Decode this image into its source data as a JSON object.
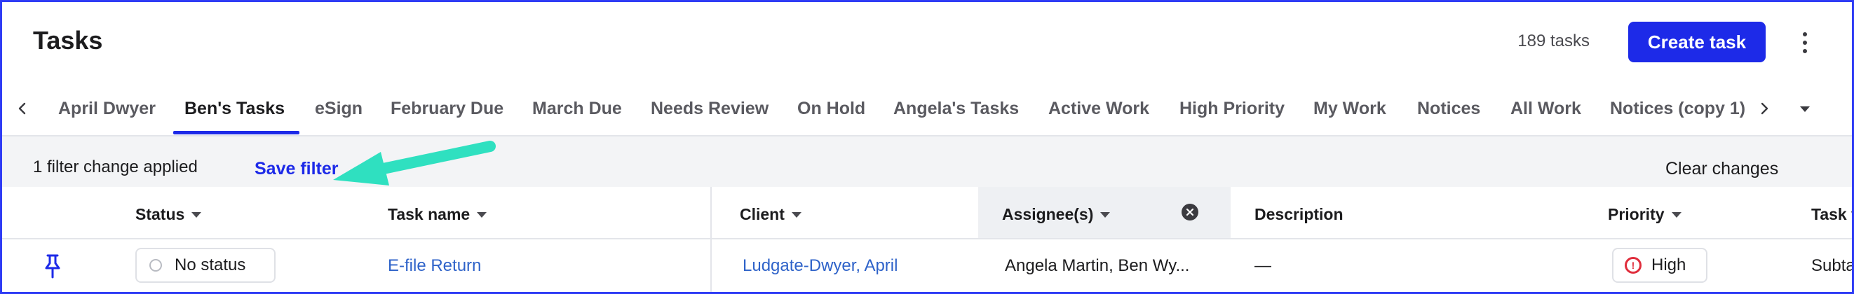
{
  "header": {
    "title": "Tasks",
    "task_count": "189 tasks",
    "create_label": "Create task"
  },
  "tabs": [
    {
      "label": "April Dwyer"
    },
    {
      "label": "Ben's Tasks"
    },
    {
      "label": "eSign"
    },
    {
      "label": "February Due"
    },
    {
      "label": "March Due"
    },
    {
      "label": "Needs Review"
    },
    {
      "label": "On Hold"
    },
    {
      "label": "Angela's Tasks"
    },
    {
      "label": "Active Work"
    },
    {
      "label": "High Priority"
    },
    {
      "label": "My Work"
    },
    {
      "label": "Notices"
    },
    {
      "label": "All Work"
    },
    {
      "label": "Notices (copy 1)"
    }
  ],
  "active_tab": "Ben's Tasks",
  "filter_bar": {
    "status_text": "1 filter change applied",
    "save_label": "Save filter",
    "clear_label": "Clear changes"
  },
  "columns": {
    "status": "Status",
    "task_name": "Task name",
    "client": "Client",
    "assignees": "Assignee(s)",
    "description": "Description",
    "priority": "Priority",
    "task_type": "Task t"
  },
  "rows": [
    {
      "status": "No status",
      "task_name": "E-file Return",
      "client": "Ludgate-Dwyer, April",
      "assignees": "Angela Martin, Ben Wy...",
      "description": "—",
      "priority": "High",
      "task_type": "Subta"
    }
  ],
  "colors": {
    "accent": "#1d2ae8",
    "link": "#2f63c9",
    "annotation_arrow": "#2fe0c0",
    "priority_high": "#e02d3c"
  },
  "icons": {
    "tabs_prev": "chevron-left-icon",
    "tabs_next": "chevron-right-icon",
    "tabs_menu": "caret-down-icon",
    "more": "more-vertical-icon",
    "pin": "pin-icon",
    "clear_assignee": "close-circle-icon",
    "priority": "alert-circle-icon"
  }
}
